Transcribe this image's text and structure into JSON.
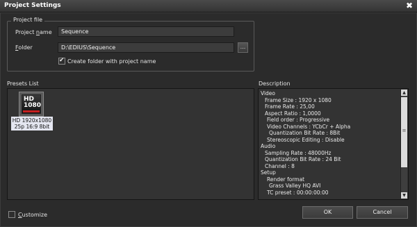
{
  "window": {
    "title": "Project Settings",
    "close_glyph": "✖",
    "close_icon": "close-icon"
  },
  "project_file": {
    "group_title": "Project file",
    "name_label_underlined": "n",
    "name_label_pre": "Project ",
    "name_label_post": "ame",
    "name_value": "Sequence",
    "folder_label_underlined": "F",
    "folder_label_rest": "older",
    "folder_value": "D:\\EDIUS\\Sequence",
    "browse_label": "...",
    "create_folder_label": "Create folder with project name",
    "create_folder_checked": true
  },
  "presets": {
    "section_label": "Presets List",
    "items": [
      {
        "icon_hd": "HD",
        "icon_res": "1080",
        "caption_line1": "HD 1920x1080",
        "caption_line2": "25p 16:9 8bit",
        "selected": true
      }
    ]
  },
  "description": {
    "section_label": "Description",
    "lines": [
      {
        "text": "Video",
        "indent": 0
      },
      {
        "text": "Frame Size : 1920 x 1080",
        "indent": 1
      },
      {
        "text": "Frame Rate : 25,00",
        "indent": 1
      },
      {
        "text": "Aspect Ratio : 1,0000",
        "indent": 1
      },
      {
        "text": "Field order : Progressive",
        "indent": 2
      },
      {
        "text": "Video Channels : YCbCr + Alpha",
        "indent": 2
      },
      {
        "text": "Quantization Bit Rate :  8Bit",
        "indent": 3
      },
      {
        "text": "Stereoscopic Editing : Disable",
        "indent": 2
      },
      {
        "text": "Audio",
        "indent": 0
      },
      {
        "text": "Sampling Rate : 48000Hz",
        "indent": 1
      },
      {
        "text": "Quantization Bit Rate : 24 Bit",
        "indent": 1
      },
      {
        "text": "Channel : 8",
        "indent": 1
      },
      {
        "text": "Setup",
        "indent": 0
      },
      {
        "text": "Render format",
        "indent": 2
      },
      {
        "text": "Grass Valley HQ AVI",
        "indent": 3
      },
      {
        "text": "TC preset : 00:00:00:00",
        "indent": 2
      }
    ],
    "scroll_up": "▲",
    "scroll_down": "▼",
    "scroll_grip": "≡"
  },
  "footer": {
    "customize_underlined": "C",
    "customize_rest": "ustomize",
    "customize_checked": false,
    "ok_label": "OK",
    "cancel_label": "Cancel"
  }
}
